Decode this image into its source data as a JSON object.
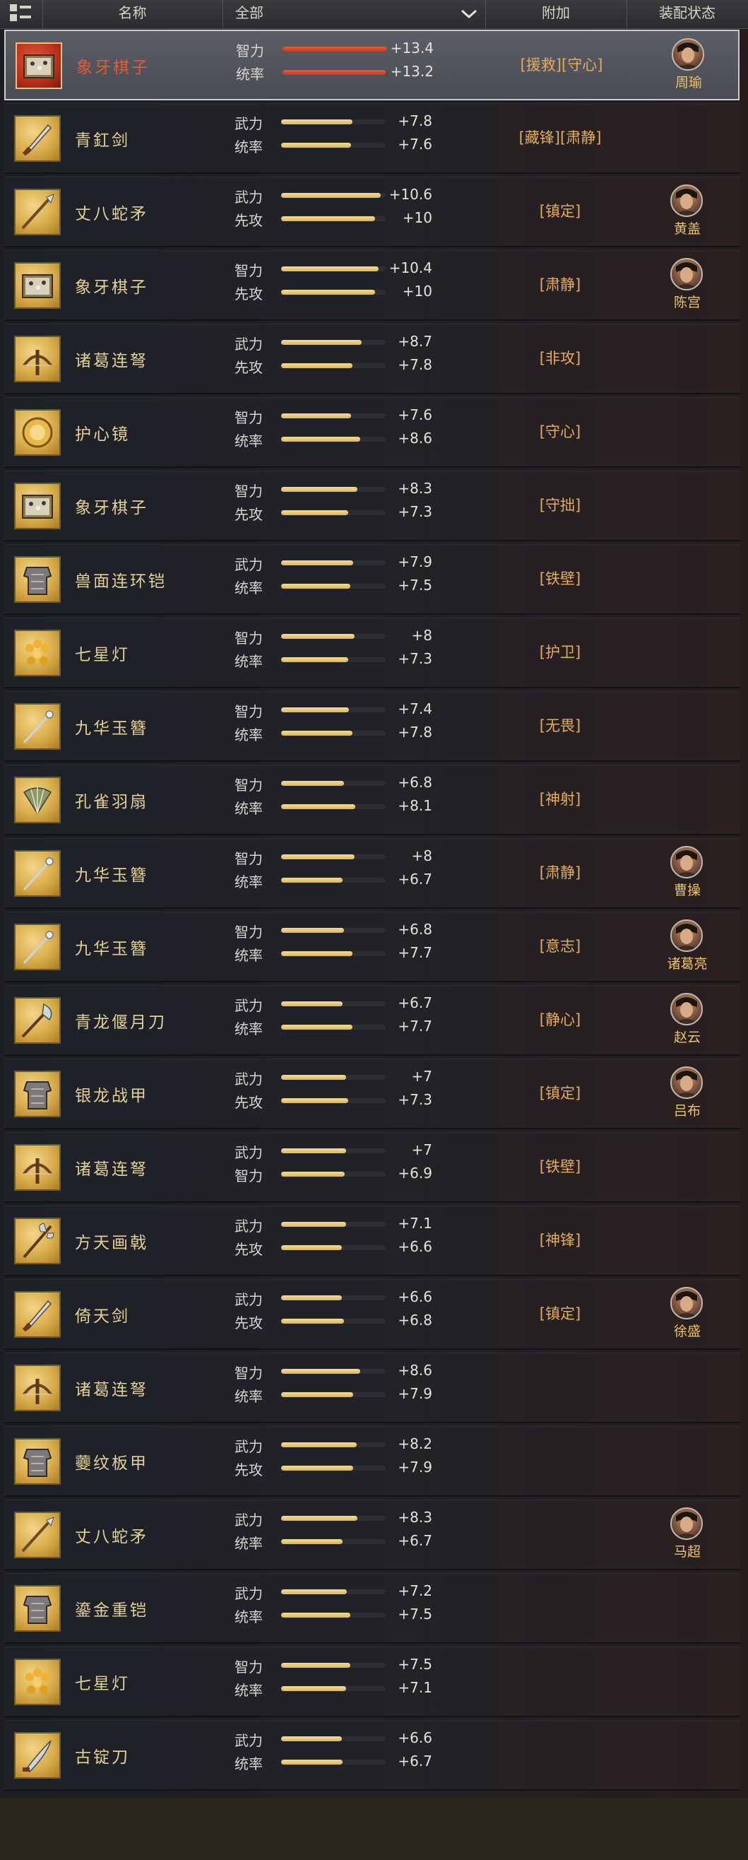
{
  "header": {
    "name_col": "名称",
    "filter": "全部",
    "extra_col": "附加",
    "equip_col": "装配状态"
  },
  "colors": {
    "accent_gold": "#e4ab60",
    "name_gold": "#e3cf98",
    "selected_red": "#e55a37",
    "bar_gold": "#d9b762",
    "bar_red": "#c53b22"
  },
  "items": [
    {
      "name": "象牙棋子",
      "icon": "chess-box-icon",
      "selected": true,
      "stats": [
        {
          "label": "智力",
          "value": "+13.4",
          "fill": 1.0
        },
        {
          "label": "统率",
          "value": "+13.2",
          "fill": 0.99
        }
      ],
      "tags": "[援救][守心]",
      "general": "周瑜"
    },
    {
      "name": "青釭剑",
      "icon": "sword-icon",
      "stats": [
        {
          "label": "武力",
          "value": "+7.8",
          "fill": 0.68
        },
        {
          "label": "统率",
          "value": "+7.6",
          "fill": 0.67
        }
      ],
      "tags": "[藏锋][肃静]",
      "general": ""
    },
    {
      "name": "丈八蛇矛",
      "icon": "spear-icon",
      "stats": [
        {
          "label": "武力",
          "value": "+10.6",
          "fill": 0.95
        },
        {
          "label": "先攻",
          "value": "+10",
          "fill": 0.9
        }
      ],
      "tags": "[镇定]",
      "general": "黄盖"
    },
    {
      "name": "象牙棋子",
      "icon": "chess-box-icon",
      "stats": [
        {
          "label": "智力",
          "value": "+10.4",
          "fill": 0.93
        },
        {
          "label": "先攻",
          "value": "+10",
          "fill": 0.9
        }
      ],
      "tags": "[肃静]",
      "general": "陈宫"
    },
    {
      "name": "诸葛连弩",
      "icon": "crossbow-icon",
      "stats": [
        {
          "label": "武力",
          "value": "+8.7",
          "fill": 0.77
        },
        {
          "label": "先攻",
          "value": "+7.8",
          "fill": 0.68
        }
      ],
      "tags": "[非攻]",
      "general": ""
    },
    {
      "name": "护心镜",
      "icon": "mirror-icon",
      "stats": [
        {
          "label": "智力",
          "value": "+7.6",
          "fill": 0.67
        },
        {
          "label": "统率",
          "value": "+8.6",
          "fill": 0.76
        }
      ],
      "tags": "[守心]",
      "general": ""
    },
    {
      "name": "象牙棋子",
      "icon": "chess-box-icon",
      "stats": [
        {
          "label": "智力",
          "value": "+8.3",
          "fill": 0.73
        },
        {
          "label": "先攻",
          "value": "+7.3",
          "fill": 0.64
        }
      ],
      "tags": "[守拙]",
      "general": ""
    },
    {
      "name": "兽面连环铠",
      "icon": "armor-icon",
      "stats": [
        {
          "label": "武力",
          "value": "+7.9",
          "fill": 0.69
        },
        {
          "label": "统率",
          "value": "+7.5",
          "fill": 0.66
        }
      ],
      "tags": "[铁壁]",
      "general": ""
    },
    {
      "name": "七星灯",
      "icon": "lamp-icon",
      "stats": [
        {
          "label": "智力",
          "value": "+8",
          "fill": 0.7
        },
        {
          "label": "统率",
          "value": "+7.3",
          "fill": 0.64
        }
      ],
      "tags": "[护卫]",
      "general": ""
    },
    {
      "name": "九华玉簪",
      "icon": "hairpin-icon",
      "stats": [
        {
          "label": "智力",
          "value": "+7.4",
          "fill": 0.65
        },
        {
          "label": "统率",
          "value": "+7.8",
          "fill": 0.68
        }
      ],
      "tags": "[无畏]",
      "general": ""
    },
    {
      "name": "孔雀羽扇",
      "icon": "fan-icon",
      "stats": [
        {
          "label": "智力",
          "value": "+6.8",
          "fill": 0.6
        },
        {
          "label": "统率",
          "value": "+8.1",
          "fill": 0.71
        }
      ],
      "tags": "[神射]",
      "general": ""
    },
    {
      "name": "九华玉簪",
      "icon": "hairpin-icon",
      "stats": [
        {
          "label": "智力",
          "value": "+8",
          "fill": 0.7
        },
        {
          "label": "统率",
          "value": "+6.7",
          "fill": 0.59
        }
      ],
      "tags": "[肃静]",
      "general": "曹操"
    },
    {
      "name": "九华玉簪",
      "icon": "hairpin-icon",
      "stats": [
        {
          "label": "智力",
          "value": "+6.8",
          "fill": 0.6
        },
        {
          "label": "统率",
          "value": "+7.7",
          "fill": 0.68
        }
      ],
      "tags": "[意志]",
      "general": "诸葛亮"
    },
    {
      "name": "青龙偃月刀",
      "icon": "glaive-icon",
      "stats": [
        {
          "label": "武力",
          "value": "+6.7",
          "fill": 0.59
        },
        {
          "label": "统率",
          "value": "+7.7",
          "fill": 0.68
        }
      ],
      "tags": "[静心]",
      "general": "赵云"
    },
    {
      "name": "银龙战甲",
      "icon": "armor-icon",
      "stats": [
        {
          "label": "武力",
          "value": "+7",
          "fill": 0.62
        },
        {
          "label": "先攻",
          "value": "+7.3",
          "fill": 0.64
        }
      ],
      "tags": "[镇定]",
      "general": "吕布"
    },
    {
      "name": "诸葛连弩",
      "icon": "crossbow-icon",
      "stats": [
        {
          "label": "武力",
          "value": "+7",
          "fill": 0.62
        },
        {
          "label": "智力",
          "value": "+6.9",
          "fill": 0.61
        }
      ],
      "tags": "[铁壁]",
      "general": ""
    },
    {
      "name": "方天画戟",
      "icon": "halberd-icon",
      "stats": [
        {
          "label": "武力",
          "value": "+7.1",
          "fill": 0.62
        },
        {
          "label": "先攻",
          "value": "+6.6",
          "fill": 0.58
        }
      ],
      "tags": "[神锋]",
      "general": ""
    },
    {
      "name": "倚天剑",
      "icon": "sword-icon",
      "stats": [
        {
          "label": "武力",
          "value": "+6.6",
          "fill": 0.58
        },
        {
          "label": "先攻",
          "value": "+6.8",
          "fill": 0.6
        }
      ],
      "tags": "[镇定]",
      "general": "徐盛"
    },
    {
      "name": "诸葛连弩",
      "icon": "crossbow-icon",
      "stats": [
        {
          "label": "智力",
          "value": "+8.6",
          "fill": 0.76
        },
        {
          "label": "统率",
          "value": "+7.9",
          "fill": 0.69
        }
      ],
      "tags": "",
      "general": ""
    },
    {
      "name": "虁纹板甲",
      "icon": "armor-icon",
      "stats": [
        {
          "label": "武力",
          "value": "+8.2",
          "fill": 0.72
        },
        {
          "label": "先攻",
          "value": "+7.9",
          "fill": 0.69
        }
      ],
      "tags": "",
      "general": ""
    },
    {
      "name": "丈八蛇矛",
      "icon": "spear-icon",
      "stats": [
        {
          "label": "武力",
          "value": "+8.3",
          "fill": 0.73
        },
        {
          "label": "统率",
          "value": "+6.7",
          "fill": 0.59
        }
      ],
      "tags": "",
      "general": "马超"
    },
    {
      "name": "鎏金重铠",
      "icon": "armor-icon",
      "stats": [
        {
          "label": "武力",
          "value": "+7.2",
          "fill": 0.63
        },
        {
          "label": "统率",
          "value": "+7.5",
          "fill": 0.66
        }
      ],
      "tags": "",
      "general": ""
    },
    {
      "name": "七星灯",
      "icon": "lamp-icon",
      "stats": [
        {
          "label": "智力",
          "value": "+7.5",
          "fill": 0.66
        },
        {
          "label": "统率",
          "value": "+7.1",
          "fill": 0.62
        }
      ],
      "tags": "",
      "general": ""
    },
    {
      "name": "古锭刀",
      "icon": "saber-icon",
      "stats": [
        {
          "label": "武力",
          "value": "+6.6",
          "fill": 0.58
        },
        {
          "label": "统率",
          "value": "+6.7",
          "fill": 0.59
        }
      ],
      "tags": "",
      "general": ""
    }
  ]
}
